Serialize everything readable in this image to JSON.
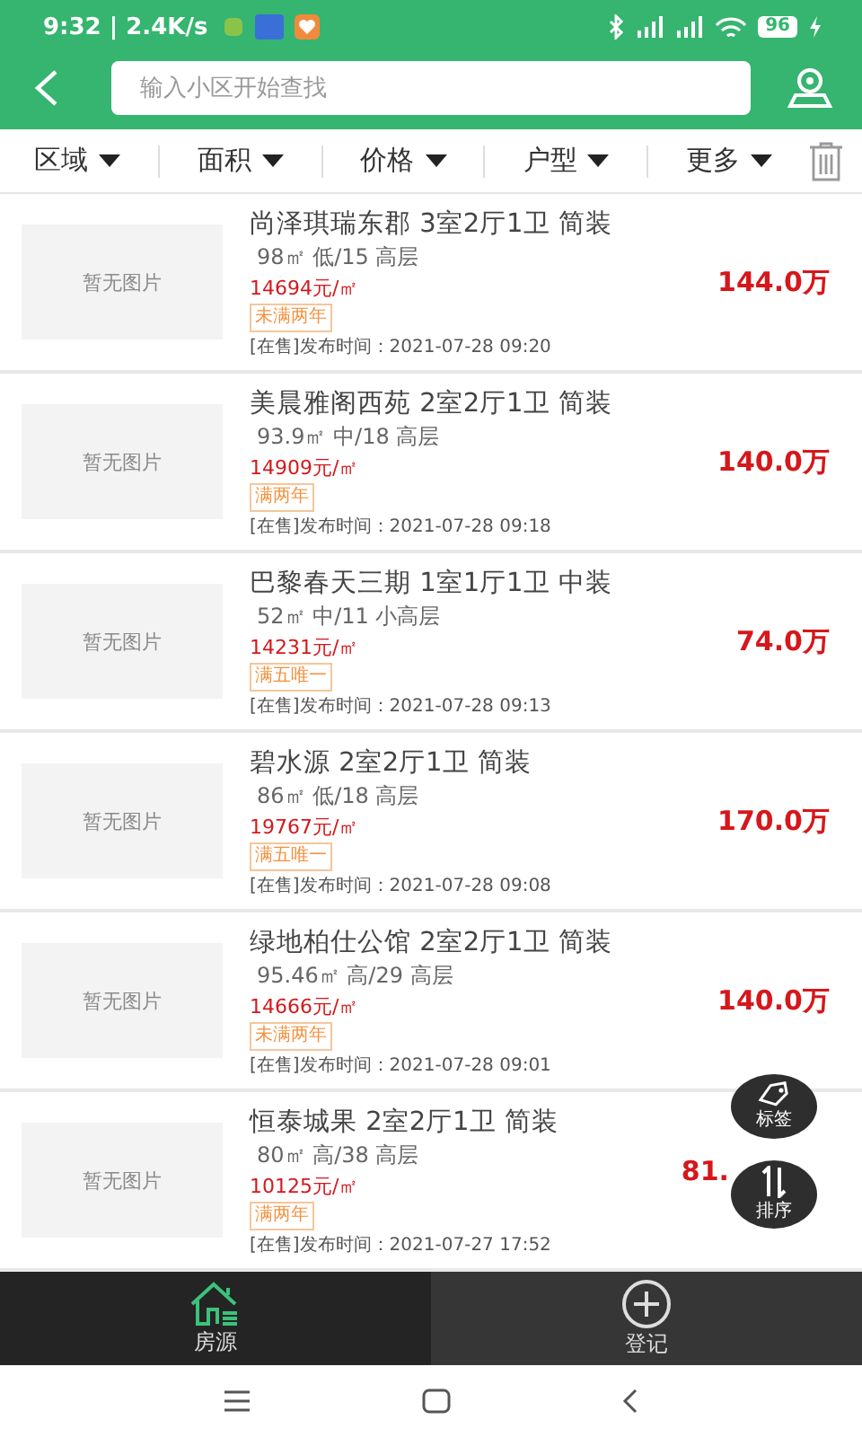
{
  "status_bar": {
    "time": "9:32 | 2.4K/s",
    "battery": "96"
  },
  "search": {
    "placeholder": "输入小区开始查找"
  },
  "filters": [
    {
      "label": "区域"
    },
    {
      "label": "面积"
    },
    {
      "label": "价格"
    },
    {
      "label": "户型"
    },
    {
      "label": "更多"
    }
  ],
  "listings": [
    {
      "image_text": "暂无图片",
      "title": "尚泽琪瑞东郡 3室2厅1卫 简装",
      "details": "98㎡ 低/15 高层",
      "unit_price": "14694元/㎡",
      "tag": "未满两年",
      "time": "[在售]发布时间：2021-07-28 09:20",
      "price": "144.0万"
    },
    {
      "image_text": "暂无图片",
      "title": "美晨雅阁西苑 2室2厅1卫 简装",
      "details": "93.9㎡ 中/18 高层",
      "unit_price": "14909元/㎡",
      "tag": "满两年",
      "time": "[在售]发布时间：2021-07-28 09:18",
      "price": "140.0万"
    },
    {
      "image_text": "暂无图片",
      "title": "巴黎春天三期 1室1厅1卫 中装",
      "details": "52㎡ 中/11 小高层",
      "unit_price": "14231元/㎡",
      "tag": "满五唯一",
      "time": "[在售]发布时间：2021-07-28 09:13",
      "price": "74.0万"
    },
    {
      "image_text": "暂无图片",
      "title": "碧水源 2室2厅1卫 简装",
      "details": "86㎡ 低/18 高层",
      "unit_price": "19767元/㎡",
      "tag": "满五唯一",
      "time": "[在售]发布时间：2021-07-28 09:08",
      "price": "170.0万"
    },
    {
      "image_text": "暂无图片",
      "title": "绿地柏仕公馆 2室2厅1卫 简装",
      "details": "95.46㎡ 高/29 高层",
      "unit_price": "14666元/㎡",
      "tag": "未满两年",
      "time": "[在售]发布时间：2021-07-28 09:01",
      "price": "140.0万"
    },
    {
      "image_text": "暂无图片",
      "title": "恒泰城果 2室2厅1卫 简装",
      "details": "80㎡ 高/38 高层",
      "unit_price": "10125元/㎡",
      "tag": "满两年",
      "time": "[在售]发布时间：2021-07-27 17:52",
      "price": "81."
    }
  ],
  "floating_buttons": [
    {
      "kind": "tag",
      "label": "标签"
    },
    {
      "kind": "sort",
      "label": "排序"
    }
  ],
  "bottom_tabs": [
    {
      "kind": "house",
      "label": "房源",
      "selected": true
    },
    {
      "kind": "add",
      "label": "登记",
      "selected": false
    }
  ]
}
